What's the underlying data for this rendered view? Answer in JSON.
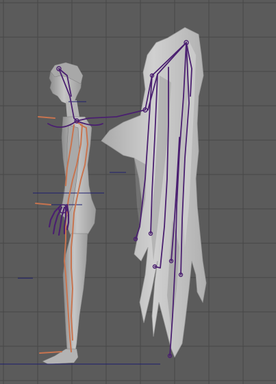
{
  "viewport": {
    "view": "side",
    "background_color": "#5b5b5b",
    "grid_color": "#474747",
    "mesh_color": "#b9b9b9",
    "mesh_shadow_color": "#8f8f8f",
    "wing_color": "#c4c4c4",
    "wing_shadow_color": "#9a9a9a",
    "body_bone_color": "#c8744f",
    "wing_bone_color": "#4a1f70",
    "guide_line_color": "#1c1c6e"
  },
  "scene": {
    "objects": [
      "character-mesh",
      "wing-mesh",
      "body-skeleton",
      "wing-skeleton",
      "hand-rig"
    ]
  }
}
